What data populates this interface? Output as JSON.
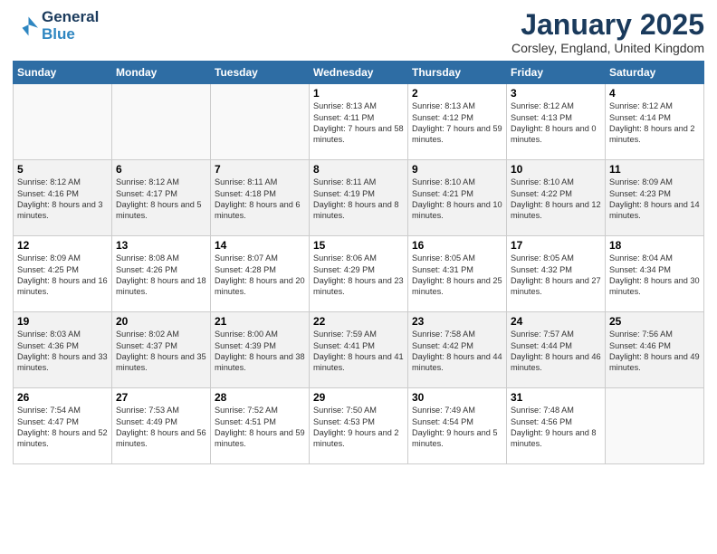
{
  "header": {
    "logo_line1": "General",
    "logo_line2": "Blue",
    "month": "January 2025",
    "location": "Corsley, England, United Kingdom"
  },
  "weekdays": [
    "Sunday",
    "Monday",
    "Tuesday",
    "Wednesday",
    "Thursday",
    "Friday",
    "Saturday"
  ],
  "weeks": [
    [
      {
        "day": "",
        "content": ""
      },
      {
        "day": "",
        "content": ""
      },
      {
        "day": "",
        "content": ""
      },
      {
        "day": "1",
        "content": "Sunrise: 8:13 AM\nSunset: 4:11 PM\nDaylight: 7 hours\nand 58 minutes."
      },
      {
        "day": "2",
        "content": "Sunrise: 8:13 AM\nSunset: 4:12 PM\nDaylight: 7 hours\nand 59 minutes."
      },
      {
        "day": "3",
        "content": "Sunrise: 8:12 AM\nSunset: 4:13 PM\nDaylight: 8 hours\nand 0 minutes."
      },
      {
        "day": "4",
        "content": "Sunrise: 8:12 AM\nSunset: 4:14 PM\nDaylight: 8 hours\nand 2 minutes."
      }
    ],
    [
      {
        "day": "5",
        "content": "Sunrise: 8:12 AM\nSunset: 4:16 PM\nDaylight: 8 hours\nand 3 minutes."
      },
      {
        "day": "6",
        "content": "Sunrise: 8:12 AM\nSunset: 4:17 PM\nDaylight: 8 hours\nand 5 minutes."
      },
      {
        "day": "7",
        "content": "Sunrise: 8:11 AM\nSunset: 4:18 PM\nDaylight: 8 hours\nand 6 minutes."
      },
      {
        "day": "8",
        "content": "Sunrise: 8:11 AM\nSunset: 4:19 PM\nDaylight: 8 hours\nand 8 minutes."
      },
      {
        "day": "9",
        "content": "Sunrise: 8:10 AM\nSunset: 4:21 PM\nDaylight: 8 hours\nand 10 minutes."
      },
      {
        "day": "10",
        "content": "Sunrise: 8:10 AM\nSunset: 4:22 PM\nDaylight: 8 hours\nand 12 minutes."
      },
      {
        "day": "11",
        "content": "Sunrise: 8:09 AM\nSunset: 4:23 PM\nDaylight: 8 hours\nand 14 minutes."
      }
    ],
    [
      {
        "day": "12",
        "content": "Sunrise: 8:09 AM\nSunset: 4:25 PM\nDaylight: 8 hours\nand 16 minutes."
      },
      {
        "day": "13",
        "content": "Sunrise: 8:08 AM\nSunset: 4:26 PM\nDaylight: 8 hours\nand 18 minutes."
      },
      {
        "day": "14",
        "content": "Sunrise: 8:07 AM\nSunset: 4:28 PM\nDaylight: 8 hours\nand 20 minutes."
      },
      {
        "day": "15",
        "content": "Sunrise: 8:06 AM\nSunset: 4:29 PM\nDaylight: 8 hours\nand 23 minutes."
      },
      {
        "day": "16",
        "content": "Sunrise: 8:05 AM\nSunset: 4:31 PM\nDaylight: 8 hours\nand 25 minutes."
      },
      {
        "day": "17",
        "content": "Sunrise: 8:05 AM\nSunset: 4:32 PM\nDaylight: 8 hours\nand 27 minutes."
      },
      {
        "day": "18",
        "content": "Sunrise: 8:04 AM\nSunset: 4:34 PM\nDaylight: 8 hours\nand 30 minutes."
      }
    ],
    [
      {
        "day": "19",
        "content": "Sunrise: 8:03 AM\nSunset: 4:36 PM\nDaylight: 8 hours\nand 33 minutes."
      },
      {
        "day": "20",
        "content": "Sunrise: 8:02 AM\nSunset: 4:37 PM\nDaylight: 8 hours\nand 35 minutes."
      },
      {
        "day": "21",
        "content": "Sunrise: 8:00 AM\nSunset: 4:39 PM\nDaylight: 8 hours\nand 38 minutes."
      },
      {
        "day": "22",
        "content": "Sunrise: 7:59 AM\nSunset: 4:41 PM\nDaylight: 8 hours\nand 41 minutes."
      },
      {
        "day": "23",
        "content": "Sunrise: 7:58 AM\nSunset: 4:42 PM\nDaylight: 8 hours\nand 44 minutes."
      },
      {
        "day": "24",
        "content": "Sunrise: 7:57 AM\nSunset: 4:44 PM\nDaylight: 8 hours\nand 46 minutes."
      },
      {
        "day": "25",
        "content": "Sunrise: 7:56 AM\nSunset: 4:46 PM\nDaylight: 8 hours\nand 49 minutes."
      }
    ],
    [
      {
        "day": "26",
        "content": "Sunrise: 7:54 AM\nSunset: 4:47 PM\nDaylight: 8 hours\nand 52 minutes."
      },
      {
        "day": "27",
        "content": "Sunrise: 7:53 AM\nSunset: 4:49 PM\nDaylight: 8 hours\nand 56 minutes."
      },
      {
        "day": "28",
        "content": "Sunrise: 7:52 AM\nSunset: 4:51 PM\nDaylight: 8 hours\nand 59 minutes."
      },
      {
        "day": "29",
        "content": "Sunrise: 7:50 AM\nSunset: 4:53 PM\nDaylight: 9 hours\nand 2 minutes."
      },
      {
        "day": "30",
        "content": "Sunrise: 7:49 AM\nSunset: 4:54 PM\nDaylight: 9 hours\nand 5 minutes."
      },
      {
        "day": "31",
        "content": "Sunrise: 7:48 AM\nSunset: 4:56 PM\nDaylight: 9 hours\nand 8 minutes."
      },
      {
        "day": "",
        "content": ""
      }
    ]
  ]
}
